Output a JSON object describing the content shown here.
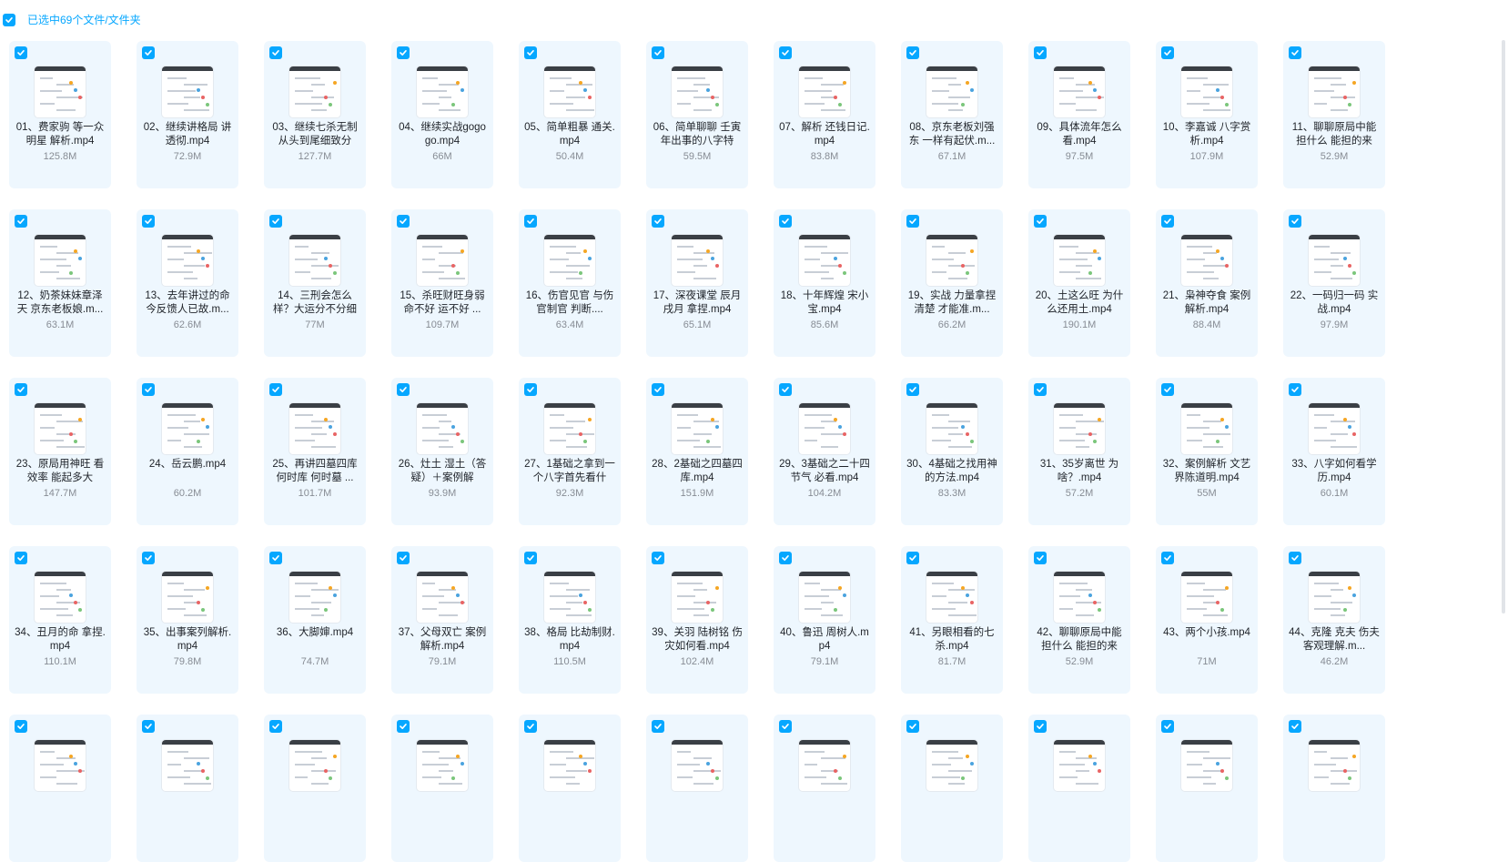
{
  "header": {
    "selection_text": "已选中69个文件/文件夹",
    "select_all_checked": true
  },
  "accent_color": "#06a7ff",
  "icons": {
    "checkbox": "checkbox-checked-icon"
  },
  "files": [
    {
      "name": "01、费家驹 等一众明星 解析.mp4",
      "size": "125.8M"
    },
    {
      "name": "02、继续讲格局 讲透彻.mp4",
      "size": "72.9M"
    },
    {
      "name": "03、继续七杀无制 从头到尾细致分",
      "size": "127.7M"
    },
    {
      "name": "04、继续实战gogogo.mp4",
      "size": "66M"
    },
    {
      "name": "05、简单粗暴 通关.mp4",
      "size": "50.4M"
    },
    {
      "name": "06、简单聊聊 壬寅年出事的八字特",
      "size": "59.5M"
    },
    {
      "name": "07、解析 还钱日记.mp4",
      "size": "83.8M"
    },
    {
      "name": "08、京东老板刘强东 一样有起伏.m...",
      "size": "67.1M"
    },
    {
      "name": "09、具体流年怎么看.mp4",
      "size": "97.5M"
    },
    {
      "name": "10、李嘉诚 八字赏析.mp4",
      "size": "107.9M"
    },
    {
      "name": "11、聊聊原局中能担什么 能担的来",
      "size": "52.9M"
    },
    {
      "name": "12、奶茶妹妹章泽天 京东老板娘.m...",
      "size": "63.1M"
    },
    {
      "name": "13、去年讲过的命 今反馈人已故.m...",
      "size": "62.6M"
    },
    {
      "name": "14、三刑会怎么样？大运分不分细",
      "size": "77M"
    },
    {
      "name": "15、杀旺财旺身弱命不好 运不好 ...",
      "size": "109.7M"
    },
    {
      "name": "16、伤官见官 与伤官制官 判断....",
      "size": "63.4M"
    },
    {
      "name": "17、深夜课堂 辰月戌月 拿捏.mp4",
      "size": "65.1M"
    },
    {
      "name": "18、十年辉煌 宋小宝.mp4",
      "size": "85.6M"
    },
    {
      "name": "19、实战 力量拿捏清楚 才能准.m...",
      "size": "66.2M"
    },
    {
      "name": "20、土这么旺 为什么还用土.mp4",
      "size": "190.1M"
    },
    {
      "name": "21、枭神夺食 案例解析.mp4",
      "size": "88.4M"
    },
    {
      "name": "22、一码归一码 实战.mp4",
      "size": "97.9M"
    },
    {
      "name": "23、原局用神旺 看效率 能起多大",
      "size": "147.7M"
    },
    {
      "name": "24、岳云鹏.mp4",
      "size": "60.2M"
    },
    {
      "name": "25、再讲四墓四库 何时库 何时墓 ...",
      "size": "101.7M"
    },
    {
      "name": "26、灶土 湿土（答疑）＋案例解",
      "size": "93.9M"
    },
    {
      "name": "27、1基础之拿到一个八字首先看什",
      "size": "92.3M"
    },
    {
      "name": "28、2基础之四墓四库.mp4",
      "size": "151.9M"
    },
    {
      "name": "29、3基础之二十四节气 必看.mp4",
      "size": "104.2M"
    },
    {
      "name": "30、4基础之找用神的方法.mp4",
      "size": "83.3M"
    },
    {
      "name": "31、35岁离世 为啥？.mp4",
      "size": "57.2M"
    },
    {
      "name": "32、案例解析 文艺界陈道明.mp4",
      "size": "55M"
    },
    {
      "name": "33、八字如何看学历.mp4",
      "size": "60.1M"
    },
    {
      "name": "34、丑月的命 拿捏.mp4",
      "size": "110.1M"
    },
    {
      "name": "35、出事案列解析.mp4",
      "size": "79.8M"
    },
    {
      "name": "36、大脚婶.mp4",
      "size": "74.7M"
    },
    {
      "name": "37、父母双亡 案例解析.mp4",
      "size": "79.1M"
    },
    {
      "name": "38、格局 比劫制财.mp4",
      "size": "110.5M"
    },
    {
      "name": "39、关羽 陆树铭 伤灾如何看.mp4",
      "size": "102.4M"
    },
    {
      "name": "40、鲁迅 周树人.mp4",
      "size": "79.1M"
    },
    {
      "name": "41、另眼相看的七杀.mp4",
      "size": "81.7M"
    },
    {
      "name": "42、聊聊原局中能担什么 能担的来",
      "size": "52.9M"
    },
    {
      "name": "43、两个小孩.mp4",
      "size": "71M"
    },
    {
      "name": "44、克隆 克夫 伤夫 客观理解.m...",
      "size": "46.2M"
    },
    {
      "name": "",
      "size": ""
    },
    {
      "name": "",
      "size": ""
    },
    {
      "name": "",
      "size": ""
    },
    {
      "name": "",
      "size": ""
    },
    {
      "name": "",
      "size": ""
    },
    {
      "name": "",
      "size": ""
    },
    {
      "name": "",
      "size": ""
    },
    {
      "name": "",
      "size": ""
    },
    {
      "name": "",
      "size": ""
    },
    {
      "name": "",
      "size": ""
    },
    {
      "name": "",
      "size": ""
    }
  ]
}
